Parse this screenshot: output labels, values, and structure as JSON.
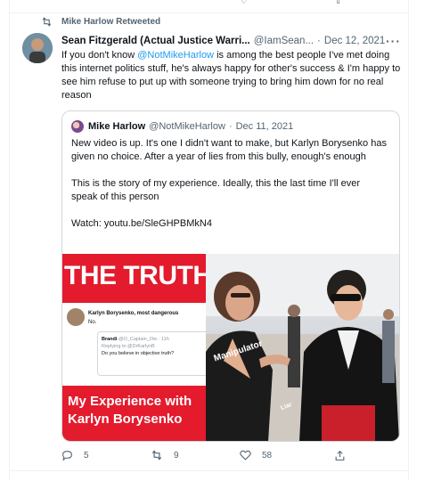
{
  "retweet": {
    "label": "Mike Harlow Retweeted"
  },
  "tweet": {
    "author_name": "Sean Fitzgerald (Actual Justice Warri...",
    "author_handle": "@IamSean...",
    "separator": "·",
    "date": "Dec 12, 2021",
    "text_part1": "If you don't know ",
    "mention": "@NotMikeHarlow",
    "text_part2": " is among the best people I've met doing this internet politics stuff, he's always happy for other's success & I'm happy to see him refuse to put up with someone trying to bring him down for no real reason"
  },
  "quote": {
    "author_name": "Mike Harlow",
    "author_handle": "@NotMikeHarlow",
    "separator": "·",
    "date": "Dec 11, 2021",
    "paragraph1": "New video is up. It's one I didn't want to make, but Karlyn Borysenko has given no choice. After a year of lies from this bully, enough's enough",
    "paragraph2": "This is the story of my experience. Ideally, this the last time I'll ever speak of this person",
    "paragraph3": "Watch: youtu.be/SleGHPBMkN4"
  },
  "thumbnail": {
    "headline": "THE TRUTH",
    "inner_name": "Karlyn Borysenko, most dangerous",
    "inner_reply": "No.",
    "reply_author": "Brandi",
    "reply_handle": "@O_Captain_Ow · 11h",
    "reply_to": "Replying to @DrKarlynB",
    "reply_text": "Do you believe in objective truth?",
    "banner_line1": "My Experience with",
    "banner_line2": "Karlyn Borysenko",
    "photo_label1": "Manipulator",
    "photo_label2": "Liar"
  },
  "actions": {
    "reply_count": "5",
    "retweet_count": "9",
    "like_count": "58"
  },
  "colors": {
    "accent": "#1d9bf0",
    "muted": "#536471",
    "banner_red": "#e31b2d"
  },
  "icons": [
    "retweet-icon",
    "more-icon",
    "reply-icon",
    "like-icon",
    "share-icon"
  ]
}
